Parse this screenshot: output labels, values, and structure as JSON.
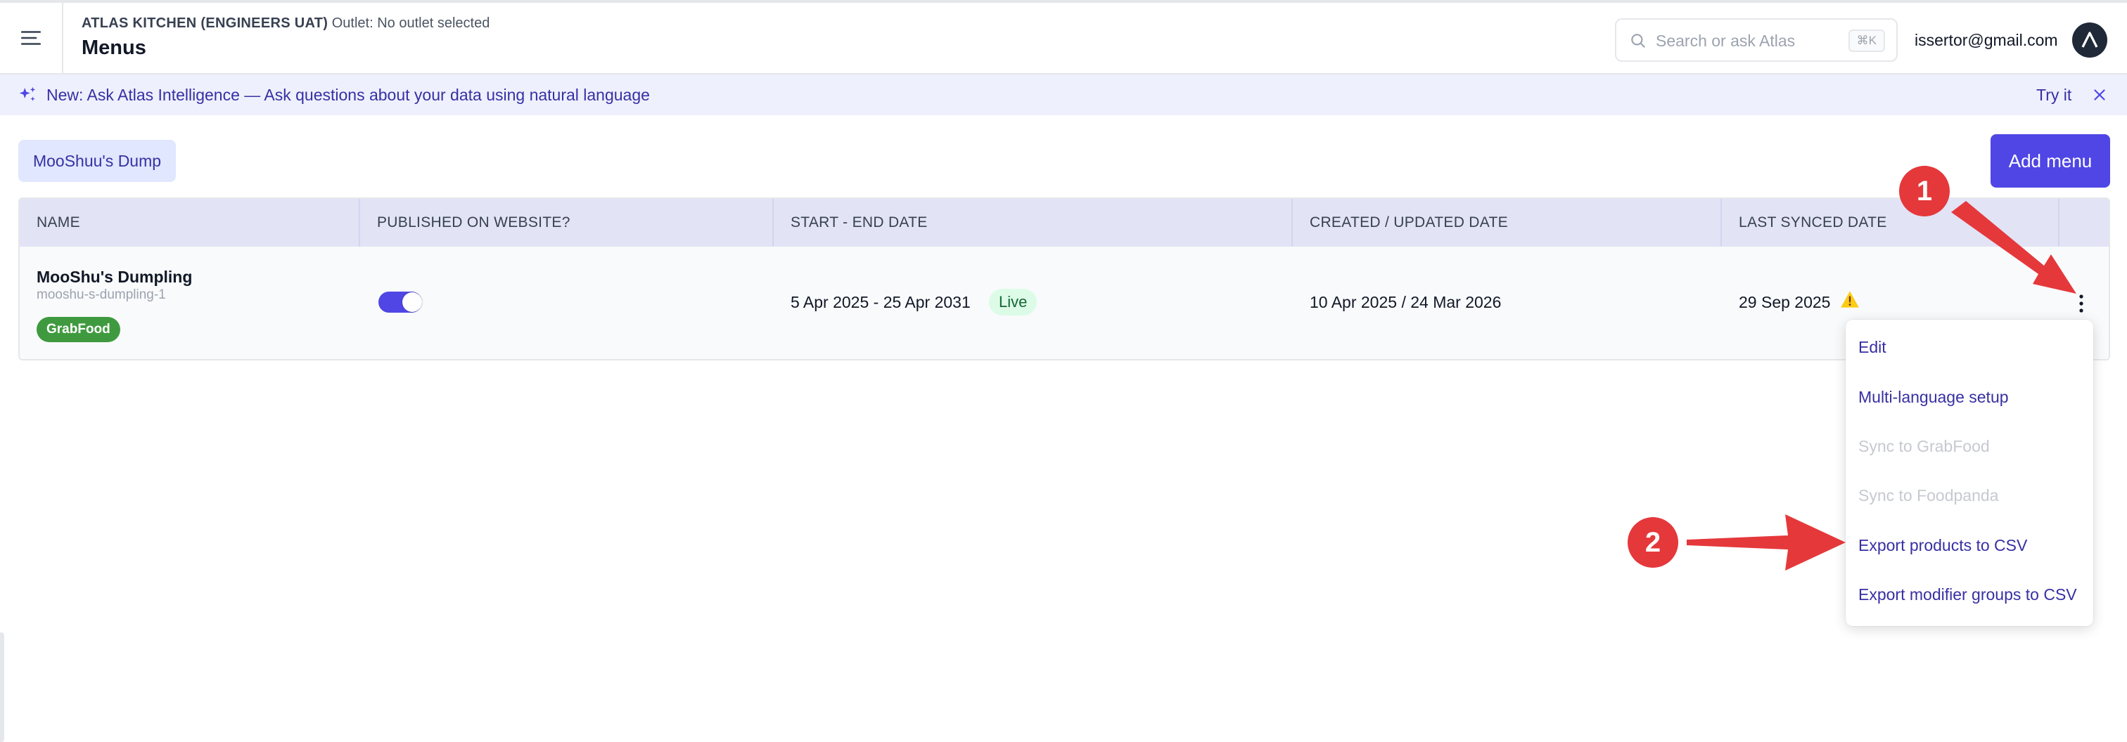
{
  "header": {
    "org_name": "ATLAS KITCHEN (ENGINEERS UAT)",
    "outlet_label": "Outlet: No outlet selected",
    "page_title": "Menus",
    "search": {
      "placeholder": "Search or ask Atlas",
      "shortcut": "⌘K"
    },
    "user_email": "issertor@gmail.com"
  },
  "banner": {
    "text": "New: Ask Atlas Intelligence — Ask questions about your data using natural language",
    "action": "Try it"
  },
  "toolbar": {
    "brand_chip": "MooShuu's Dump",
    "add_menu_label": "Add menu"
  },
  "table": {
    "columns": [
      "NAME",
      "PUBLISHED ON WEBSITE?",
      "START - END DATE",
      "CREATED / UPDATED DATE",
      "LAST SYNCED DATE"
    ],
    "rows": [
      {
        "name": "MooShu's Dumpling",
        "slug": "mooshu-s-dumpling-1",
        "channel_badge": "GrabFood",
        "published": true,
        "date_range": "5 Apr 2025 - 25 Apr 2031",
        "status": "Live",
        "created_updated": "10 Apr 2025 / 24 Mar 2026",
        "last_synced": "29 Sep 2025"
      }
    ]
  },
  "dropdown": {
    "items": [
      {
        "label": "Edit",
        "enabled": true
      },
      {
        "label": "Multi-language setup",
        "enabled": true
      },
      {
        "label": "Sync to GrabFood",
        "enabled": false
      },
      {
        "label": "Sync to Foodpanda",
        "enabled": false
      },
      {
        "label": "Export products to CSV",
        "enabled": true
      },
      {
        "label": "Export modifier groups to CSV",
        "enabled": true
      }
    ]
  },
  "annotations": {
    "step1": "1",
    "step2": "2"
  },
  "colors": {
    "accent": "#4f46e5",
    "annotation": "#e5383b",
    "live_bg": "#dcfce7",
    "grabfood": "#3f9a3f"
  }
}
